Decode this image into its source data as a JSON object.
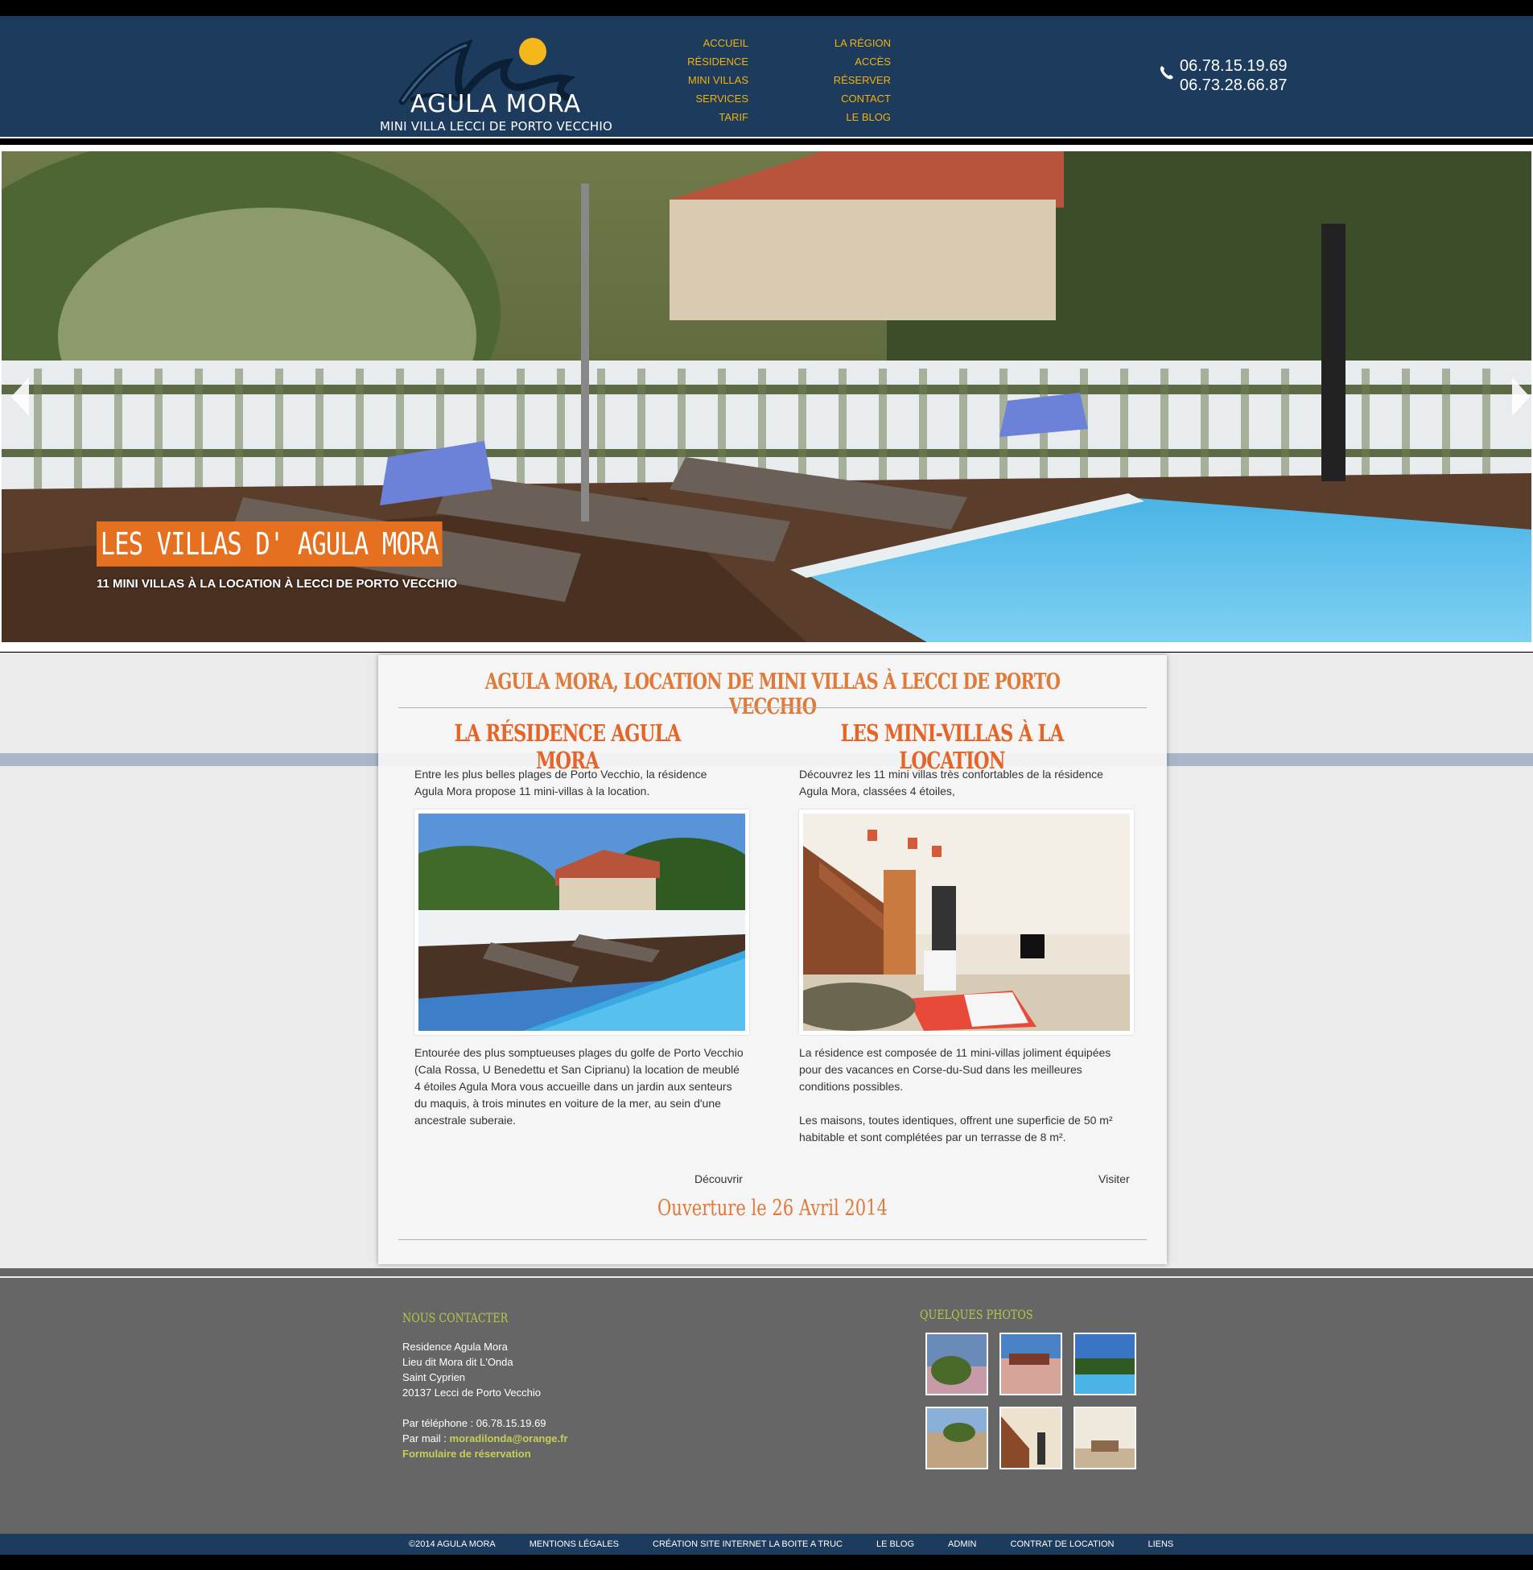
{
  "brand": {
    "title": "AGULA MORA",
    "subtitle": "MINI VILLA LECCI DE PORTO VECCHIO",
    "navy": "#1c3b5d",
    "accent": "#e57020",
    "nav_color": "#f2b20d"
  },
  "nav": {
    "col1": [
      "ACCUEIL",
      "RÉSIDENCE",
      "MINI VILLAS",
      "SERVICES",
      "TARIF"
    ],
    "col2": [
      "LA RÉGION",
      "ACCÈS",
      "RÉSERVER",
      "CONTACT",
      "LE BLOG"
    ]
  },
  "phones": {
    "icon": "phone-icon",
    "numbers": [
      "06.78.15.19.69",
      "06.73.28.66.87"
    ]
  },
  "slider": {
    "title": "LES VILLAS D' AGULA MORA",
    "subtitle": "11 MINI VILLAS À LA LOCATION À LECCI DE PORTO VECCHIO"
  },
  "main": {
    "title": "AGULA MORA, LOCATION DE MINI VILLAS À LECCI DE PORTO VECCHIO",
    "left": {
      "title": "LA RÉSIDENCE AGULA MORA",
      "intro": [
        "Entre les plus belles plages de Porto Vecchio, la résidence",
        "Agula Mora propose 11 mini-villas à la location."
      ],
      "body": [
        "Entourée des plus somptueuses plages du golfe de Porto Vecchio",
        "(Cala Rossa, U Benedettu et San Ciprianu) la location de meublé",
        "4 étoiles  Agula Mora vous accueille dans un jardin aux senteurs",
        "du maquis, à trois minutes en voiture de la mer, au sein d'une",
        "ancestrale suberaie."
      ],
      "link": "Découvrir"
    },
    "right": {
      "title": "LES MINI-VILLAS À LA LOCATION",
      "intro": [
        "Découvrez les 11 mini villas très confortables de la résidence",
        "Agula Mora, classées 4 étoiles,"
      ],
      "body": [
        "La résidence est composée de 11 mini-villas  joliment équipées",
        "pour des vacances en Corse-du-Sud dans les meilleures",
        "conditions possibles.",
        "",
        "Les maisons, toutes identiques, offrent une superficie de 50 m²",
        "habitable et sont complétées par un terrasse de 8 m²."
      ],
      "link": "Visiter"
    },
    "opening": "Ouverture le 26 Avril 2014"
  },
  "footer": {
    "contact_heading": "NOUS CONTACTER",
    "address": [
      "Residence Agula Mora",
      "Lieu dit Mora dit L'Onda",
      "Saint Cyprien",
      "20137 Lecci de Porto Vecchio"
    ],
    "phone_label": "Par téléphone : 06.78.15.19.69",
    "mail_label": "Par mail : ",
    "mail": "moradilonda@orange.fr",
    "form_link": "Formulaire de réservation",
    "photos_heading": "QUELQUES PHOTOS"
  },
  "bottom_links": [
    "©2014 AGULA MORA",
    "MENTIONS LÉGALES",
    "CRÉATION SITE INTERNET LA BOITE A TRUC",
    "LE BLOG",
    "ADMIN",
    "CONTRAT DE LOCATION",
    "LIENS"
  ]
}
